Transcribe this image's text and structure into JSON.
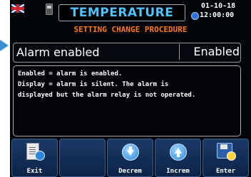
{
  "header": {
    "title": "TEMPERATURE",
    "date": "01-10-18",
    "time": "12:00:00",
    "subtitle": "SETTING CHANGE PROCEDURE"
  },
  "parameter": {
    "label": "Alarm enabled",
    "value": "Enabled"
  },
  "help": {
    "text": "Enabled = alarm is enabled.\nDisplay = alarm is silent. The alarm is\ndisplayed but the alarm relay is not operated."
  },
  "softkeys": [
    {
      "label": "Exit",
      "icon": "exit-icon"
    },
    {
      "label": "",
      "icon": ""
    },
    {
      "label": "Decrem",
      "icon": "arrow-down-icon"
    },
    {
      "label": "Increm",
      "icon": "arrow-up-icon"
    },
    {
      "label": "Enter",
      "icon": "save-enter-icon"
    }
  ],
  "colors": {
    "title": "#4fc3ff",
    "subtitle": "#ff7a1a",
    "key_bg": "#1a3a66",
    "pointer": "#3a8fd6"
  }
}
